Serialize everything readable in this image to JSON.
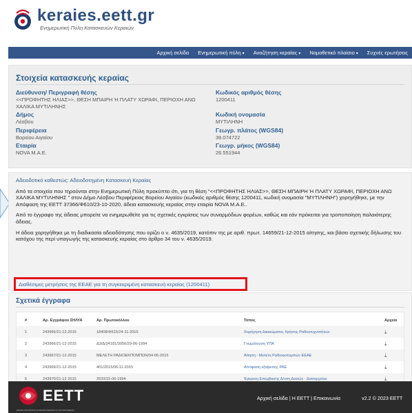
{
  "brand": {
    "title": "keraies.eett.gr",
    "subtitle": "Ενημερωτική Πύλη Κατασκευών Κεραιών",
    "accent": "#34568b",
    "logo_red": "#c8102e"
  },
  "nav": {
    "items": [
      {
        "label": "Αρχική σελίδα",
        "caret": ""
      },
      {
        "label": "Ενημερωτική πύλη",
        "caret": "▾"
      },
      {
        "label": "Αναζήτηση κεραίας",
        "caret": "▾"
      },
      {
        "label": "Νομοθετικό πλαίσιο",
        "caret": "▾"
      },
      {
        "label": "Συχνές ερωτήσεις",
        "caret": ""
      }
    ]
  },
  "details": {
    "title": "Στοιχεία κατασκευής κεραίας",
    "left": [
      {
        "label": "Διεύθυνση/ Περιγραφή θέσης",
        "value": "<<ΠΡΟΦΗΤΗΣ ΗΛΙΑΣ>>, ΘΕΣΗ ΜΠΑΙΡΗ Ή ΠΛΑΤΥ ΧΩΡΑΦΙ, ΠΕΡΙΟΧΗ ΑΝΩ ΧΑΛΙΚΑ ΜΥΤΙΛΗΝΗΣ"
      },
      {
        "label": "Δήμος",
        "value": "Λέσβου"
      },
      {
        "label": "Περιφέρεια",
        "value": "Βορείου Αιγαίου"
      },
      {
        "label": "Εταιρία",
        "value": "NOVA M.A.E."
      }
    ],
    "right": [
      {
        "label": "Κωδικός αριθμός θέσης",
        "value": "1200411"
      },
      {
        "label": "Κωδική ονομασία",
        "value": "ΜΥΤΙΛΗΝΗ"
      },
      {
        "label": "Γεωγρ. πλάτος (WGS84)",
        "value": "39.074722"
      },
      {
        "label": "Γεωγρ. μήκος (WGS84)",
        "value": "26.551944"
      }
    ]
  },
  "licence": {
    "status_label": "Αδειοδοτικό καθεστώς:",
    "status_value": "Αδειοδοτημένη Κατασκευή Κεραίας",
    "p1": "Από τα στοιχεία που τηρούνται στην Ενημερωτική Πύλη προκύπτει ότι, για τη θέση \"<<ΠΡΟΦΗΤΗΣ ΗΛΙΑΣ>>, ΘΕΣΗ ΜΠΑΙΡΗ Ή ΠΛΑΤΥ ΧΩΡΑΦΙ, ΠΕΡΙΟΧΗ ΑΝΩ ΧΑΛΙΚΑ ΜΥΤΙΛΗΝΗΣ \" στον Δήμο Λέσβου Περιφέρειας Βορείου Αιγαίου (κωδικός αριθμός θέσης 1200411, κωδική ονομασία \"ΜΥΤΙΛΗΝΗ\") χορηγήθηκε, με την Απόφαση της ΕΕΤΤ 37366/Φ610/23-10-2020, άδεια κατασκευής κεραίας στην εταιρία NOVA M.A.E..",
    "p2": "Από το έγγραφο της άδειας μπορείτε να ενημερωθείτε για τις σχετικές εγκρίσεις των συναρμόδιων φορέων, καθώς και εάν πρόκειται για τροποποίηση παλαιότερης άδειας.",
    "p3": "Η άδεια χορηγήθηκε με τη διαδικασία αδειοδότησης που ορίζει ο ν. 4635/2019, κατόπιν της με αριθ. πρωτ. 14659/21-12-2015 αίτησης, και βάσει σχετικής δήλωσης του κατόχου της περί υπαγωγής της κατασκευής κεραίας στο άρθρο 34 του ν. 4635/2019.",
    "measurements_link": "Διαθέσιμες μετρήσεις της ΕΕΑΕ για τη συγκεκριμένη κατασκευή κεραίας (1200411)",
    "highlight_color": "#e3141b"
  },
  "documents": {
    "title": "Σχετικά έγγραφα",
    "headers": {
      "num": "#",
      "reg": "Αρ. Εγγράφου ΣΗΛΥΑ",
      "prot": "Αρ. Πρωτοκόλλου",
      "type": "Τύπος",
      "file": "Αρχείο"
    },
    "rows": [
      {
        "num": "1",
        "reg": "243965/21-12-2015",
        "prot": "18408/Φ615/24-11-2015",
        "type": "Χορήγηση Δικαιώματος Χρήσης Ραδιοσυχνοτήτων"
      },
      {
        "num": "2",
        "reg": "243966/21-12-2015",
        "prot": "Δ3/Δ/24181/3056/29-06-1994",
        "type": "Γνωμάτευση ΥΠΑ"
      },
      {
        "num": "3",
        "reg": "243967/21-12-2015",
        "prot": "ΜΕΛΕΤΗ ΡΑΔΙΟΕΚΠΟΜΠΩΝ/04-06-2015",
        "type": "Αίτηση - Μελέτη Ραδιοεκπομπών ΕΕΑΕ"
      },
      {
        "num": "4",
        "reg": "243969/21-12-2015",
        "prot": "401/2015/06-11-2015",
        "type": "Απόφαση εξαίρεσης ΡΑΕ"
      },
      {
        "num": "5",
        "reg": "243970/21-12-2015",
        "prot": "2633/15-06-1994",
        "type": "Έγκριση Επέμβασης Δ/νση Δασών - Δασαρχείου"
      }
    ],
    "download_icon": "download-icon"
  },
  "footer": {
    "logo_text": "ΕΕΤΤ",
    "small_text": "ΕΘΝΙΚΗ ΕΠΙΤΡΟΠΗ ΤΗΛΕΠΙΚΟΙΝΩΝΙΩΝ & ΤΑΧΥΔΡΟΜΕΙΩΝ",
    "links": "Αρχική σελίδα | Η ΕΕΤΤ | Επικοινωνία",
    "version": "v2.2 © 2023 EETT"
  }
}
